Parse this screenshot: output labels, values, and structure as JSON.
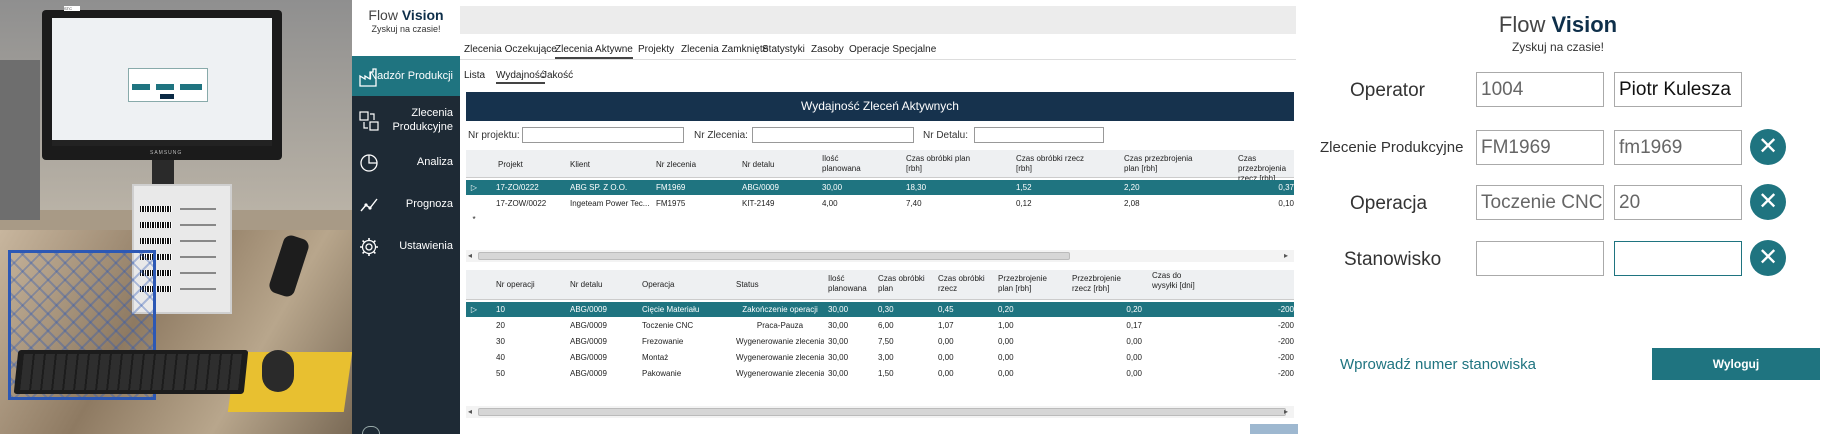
{
  "photo": {
    "monitor_brand": "SAMSUNG",
    "sticker": "STC"
  },
  "app": {
    "logo_title_prefix": "Flow",
    "logo_title_bold": "Vision",
    "logo_subtitle": "Zyskuj na czasie!",
    "nav": [
      {
        "label": "Nadzór Produkcji",
        "icon": "factory-icon",
        "active": true
      },
      {
        "label": "Zlecenia Produkcyjne",
        "icon": "orders-icon",
        "active": false
      },
      {
        "label": "Analiza",
        "icon": "analysis-icon",
        "active": false
      },
      {
        "label": "Prognoza",
        "icon": "forecast-icon",
        "active": false
      },
      {
        "label": "Ustawienia",
        "icon": "gear-icon",
        "active": false
      }
    ],
    "tabs": [
      "Zlecenia Oczekujące",
      "Zlecenia Aktywne",
      "Projekty",
      "Zlecenia Zamknięte",
      "Statystyki",
      "Zasoby",
      "Operacje Specjalne"
    ],
    "active_tab": "Zlecenia Aktywne",
    "subtabs": [
      "Lista",
      "Wydajność",
      "Jakość"
    ],
    "active_subtab": "Wydajność",
    "banner": "Wydajność Zleceń Aktywnych",
    "filters": {
      "project_label": "Nr projektu:",
      "order_label": "Nr Zlecenia:",
      "detail_label": "Nr Detalu:"
    },
    "orders_table": {
      "headers": [
        "Projekt",
        "Klient",
        "Nr zlecenia",
        "Nr detalu",
        "Ilość planowana",
        "Czas obróbki plan [rbh]",
        "Czas obróbki rzecz [rbh]",
        "Czas przezbrojenia plan [rbh]",
        "Czas przezbrojenia rzecz [rbh]"
      ],
      "rows": [
        [
          "17-ZO/0222",
          "ABG SP. Z O.O.",
          "FM1969",
          "ABG/0009",
          "30,00",
          "18,30",
          "1,52",
          "2,20",
          "0,37"
        ],
        [
          "17-ZOW/0022",
          "Ingeteam Power Tec...",
          "FM1975",
          "KIT-2149",
          "4,00",
          "7,40",
          "0,12",
          "2,08",
          "0,10"
        ]
      ],
      "selected_row": 0,
      "new_row_marker": "*"
    },
    "ops_table": {
      "headers": [
        "Nr operacji",
        "Nr detalu",
        "Operacja",
        "Status",
        "Ilość planowana",
        "Czas obróbki plan",
        "Czas obróbki rzecz",
        "Przezbrojenie plan [rbh]",
        "Przezbrojenie rzecz [rbh]",
        "Czas do wysyłki [dni]"
      ],
      "rows": [
        [
          "10",
          "ABG/0009",
          "Cięcie Materiału",
          "Zakończenie operacji",
          "30,00",
          "0,30",
          "0,45",
          "0,20",
          "0,20",
          "-200"
        ],
        [
          "20",
          "ABG/0009",
          "Toczenie CNC",
          "Praca-Pauza",
          "30,00",
          "6,00",
          "1,07",
          "1,00",
          "0,17",
          "-200"
        ],
        [
          "30",
          "ABG/0009",
          "Frezowanie",
          "Wygenerowanie zlecenia/...",
          "30,00",
          "7,50",
          "0,00",
          "0,00",
          "0,00",
          "-200"
        ],
        [
          "40",
          "ABG/0009",
          "Montaż",
          "Wygenerowanie zlecenia/...",
          "30,00",
          "3,00",
          "0,00",
          "0,00",
          "0,00",
          "-200"
        ],
        [
          "50",
          "ABG/0009",
          "Pakowanie",
          "Wygenerowanie zlecenia/...",
          "30,00",
          "1,50",
          "0,00",
          "0,00",
          "0,00",
          "-200"
        ]
      ],
      "selected_row": 0
    }
  },
  "login": {
    "title_prefix": "Flow",
    "title_bold": "Vision",
    "subtitle": "Zyskuj na czasie!",
    "operator": {
      "label": "Operator",
      "code": "1004",
      "name": "Piotr Kulesza"
    },
    "order": {
      "label": "Zlecenie Produkcyjne",
      "code": "FM1969",
      "value": "fm1969"
    },
    "operation": {
      "label": "Operacja",
      "name": "Toczenie CNC",
      "value": "20"
    },
    "station": {
      "label": "Stanowisko",
      "code": "",
      "value": ""
    },
    "clear_symbol": "✕",
    "hint": "Wprowadź numer stanowiska",
    "logout_label": "Wyloguj"
  },
  "colors": {
    "accent": "#1f7480",
    "sidebar": "#1e2a35",
    "banner": "#16324d"
  }
}
